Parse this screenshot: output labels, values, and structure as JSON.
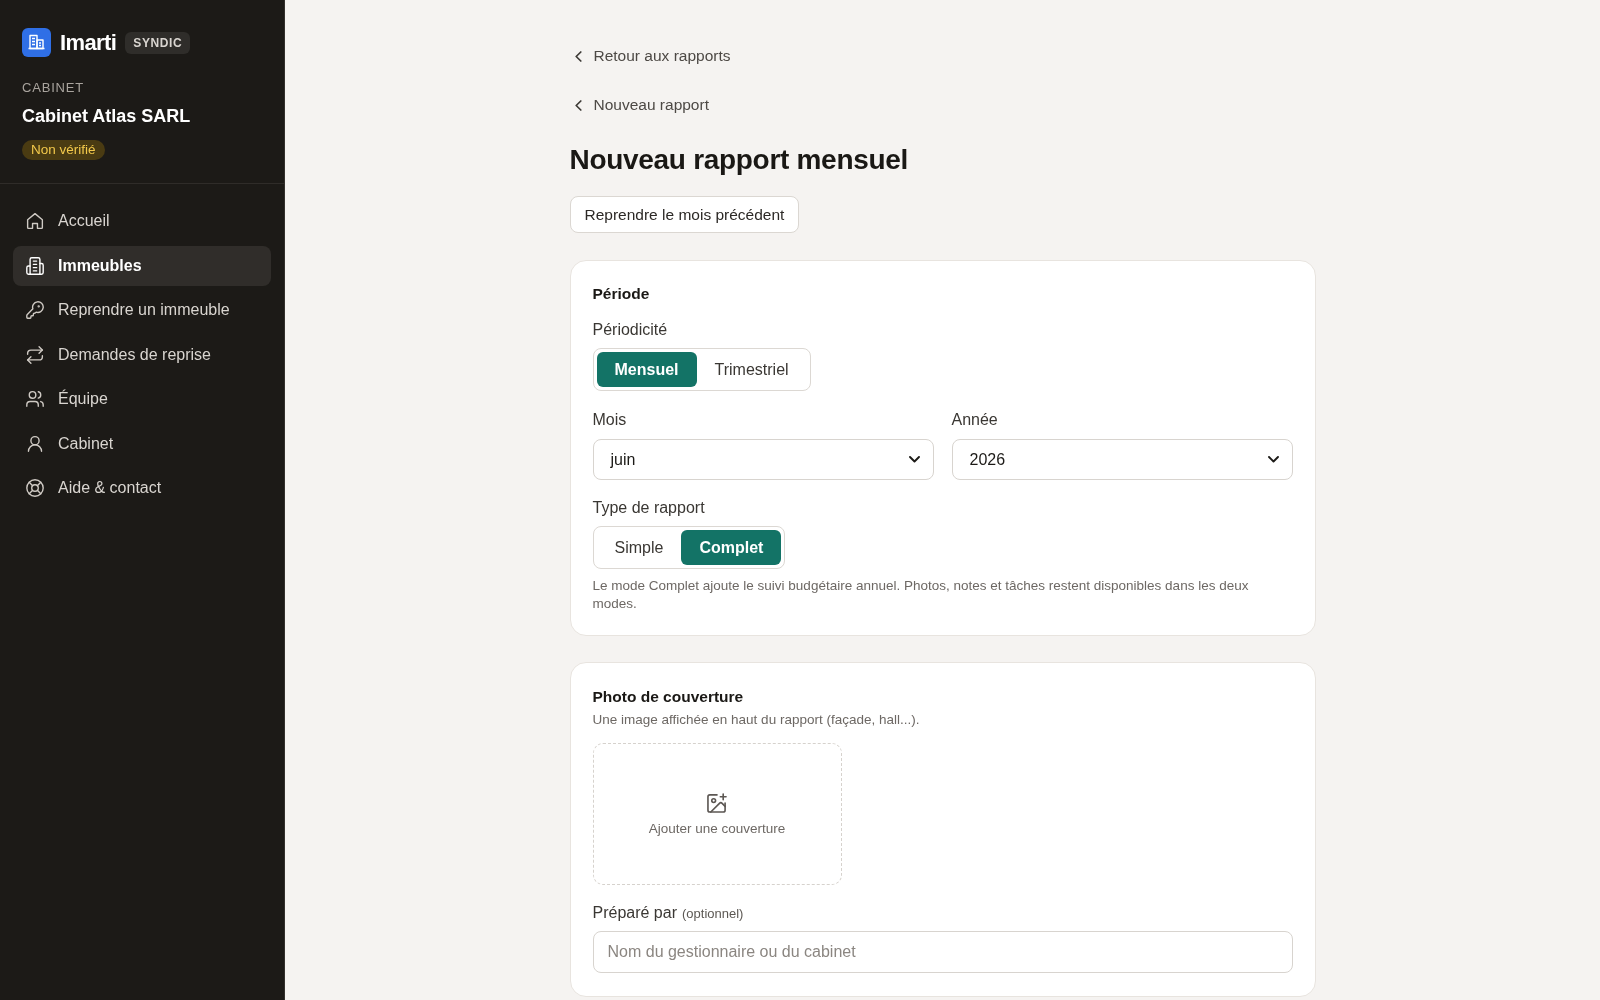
{
  "sidebar": {
    "brand": {
      "name": "Imarti",
      "badge": "SYNDIC"
    },
    "org": {
      "label": "CABINET",
      "name": "Cabinet Atlas SARL",
      "status": {
        "label": "Non vérifié",
        "verified": false
      }
    },
    "nav": [
      {
        "label": "Accueil",
        "selected": false
      },
      {
        "label": "Immeubles",
        "selected": true
      },
      {
        "label": "Reprendre un immeuble",
        "selected": false
      },
      {
        "label": "Demandes de reprise",
        "selected": false
      },
      {
        "label": "Équipe",
        "selected": false
      },
      {
        "label": "Cabinet",
        "selected": false
      },
      {
        "label": "Aide & contact",
        "selected": false
      }
    ]
  },
  "breadcrumbs": [
    {
      "label": "Retour aux rapports"
    },
    {
      "label": "Nouveau rapport"
    }
  ],
  "title": "Nouveau rapport mensuel",
  "copy_button": "Reprendre le mois précédent",
  "period_card": {
    "heading": "Période",
    "periodicity": {
      "label": "Périodicité",
      "options": [
        {
          "label": "Mensuel",
          "selected": true
        },
        {
          "label": "Trimestriel",
          "selected": false
        }
      ]
    },
    "month": {
      "label": "Mois",
      "value": "juin"
    },
    "year": {
      "label": "Année",
      "value": "2026"
    },
    "report_type": {
      "label": "Type de rapport",
      "options": [
        {
          "label": "Simple",
          "selected": false
        },
        {
          "label": "Complet",
          "selected": true
        }
      ]
    },
    "help": "Le mode Complet ajoute le suivi budgétaire annuel. Photos, notes et tâches restent disponibles dans les deux modes."
  },
  "cover_card": {
    "heading": "Photo de couverture",
    "description": "Une image affichée en haut du rapport (façade, hall...).",
    "upload": {
      "label": "Ajouter une couverture"
    },
    "prepared_by": {
      "label": "Préparé par",
      "hint": "(optionnel)",
      "placeholder": "Nom du gestionnaire ou du cabinet"
    }
  }
}
